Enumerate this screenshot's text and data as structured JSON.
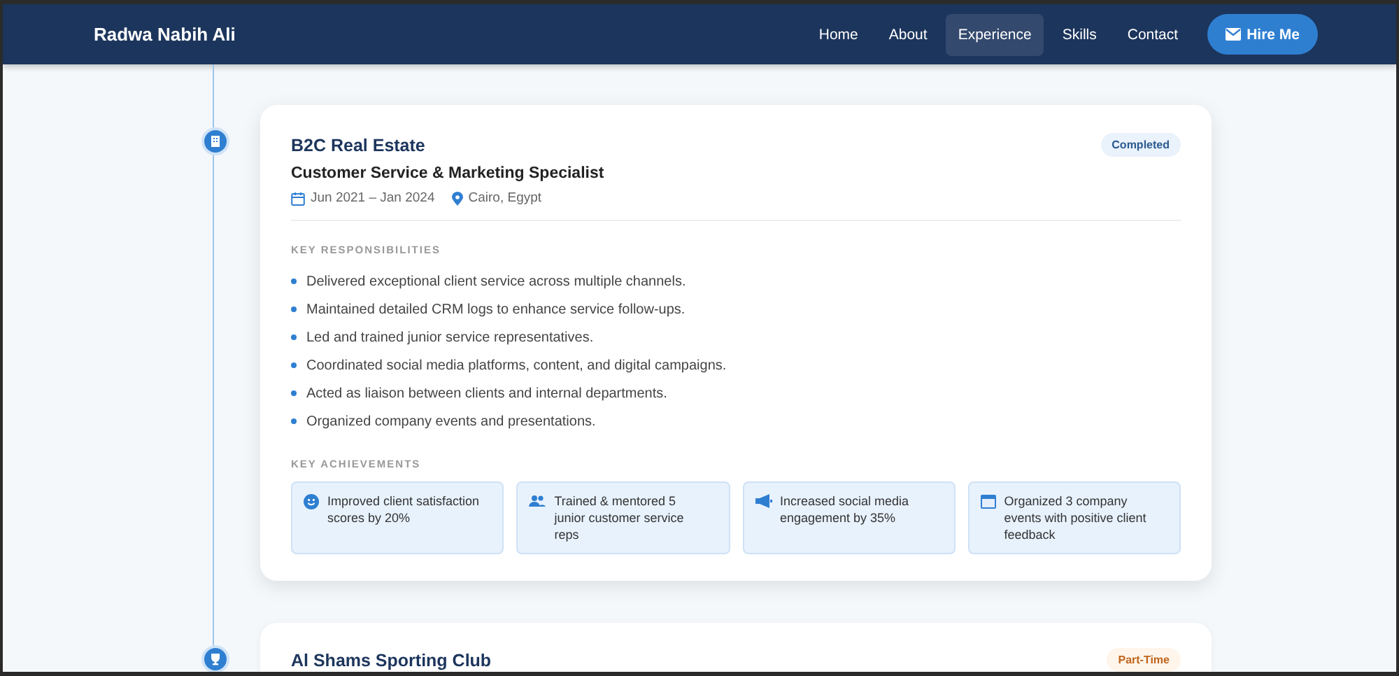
{
  "navbar": {
    "brand": "Radwa Nabih Ali",
    "links": [
      {
        "label": "Home",
        "selected": false
      },
      {
        "label": "About",
        "selected": false
      },
      {
        "label": "Experience",
        "selected": true
      },
      {
        "label": "Skills",
        "selected": false
      },
      {
        "label": "Contact",
        "selected": false
      }
    ],
    "cta": "Hire Me"
  },
  "experiences": [
    {
      "company": "B2C Real Estate",
      "kind": "building",
      "badge": {
        "label": "Completed",
        "kind": "completed"
      },
      "role": "Customer Service & Marketing Specialist",
      "dates": "Jun 2021 – Jan 2024",
      "location": "Cairo, Egypt",
      "responsibilities_heading": "KEY RESPONSIBILITIES",
      "responsibilities": [
        "Delivered exceptional client service across multiple channels.",
        "Maintained detailed CRM logs to enhance service follow-ups.",
        "Led and trained junior service representatives.",
        "Coordinated social media platforms, content, and digital campaigns.",
        "Acted as liaison between clients and internal departments.",
        "Organized company events and presentations."
      ],
      "achievements_heading": "KEY ACHIEVEMENTS",
      "achievements": [
        {
          "kind": "smile",
          "text": "Improved client satisfaction scores by 20%"
        },
        {
          "kind": "users",
          "text": "Trained & mentored 5 junior customer service reps"
        },
        {
          "kind": "megaphone",
          "text": "Increased social media engagement by 35%"
        },
        {
          "kind": "calendar",
          "text": "Organized 3 company events with positive client feedback"
        }
      ]
    },
    {
      "company": "Al Shams Sporting Club",
      "kind": "trophy",
      "badge": {
        "label": "Part-Time",
        "kind": "part-time"
      }
    }
  ]
}
